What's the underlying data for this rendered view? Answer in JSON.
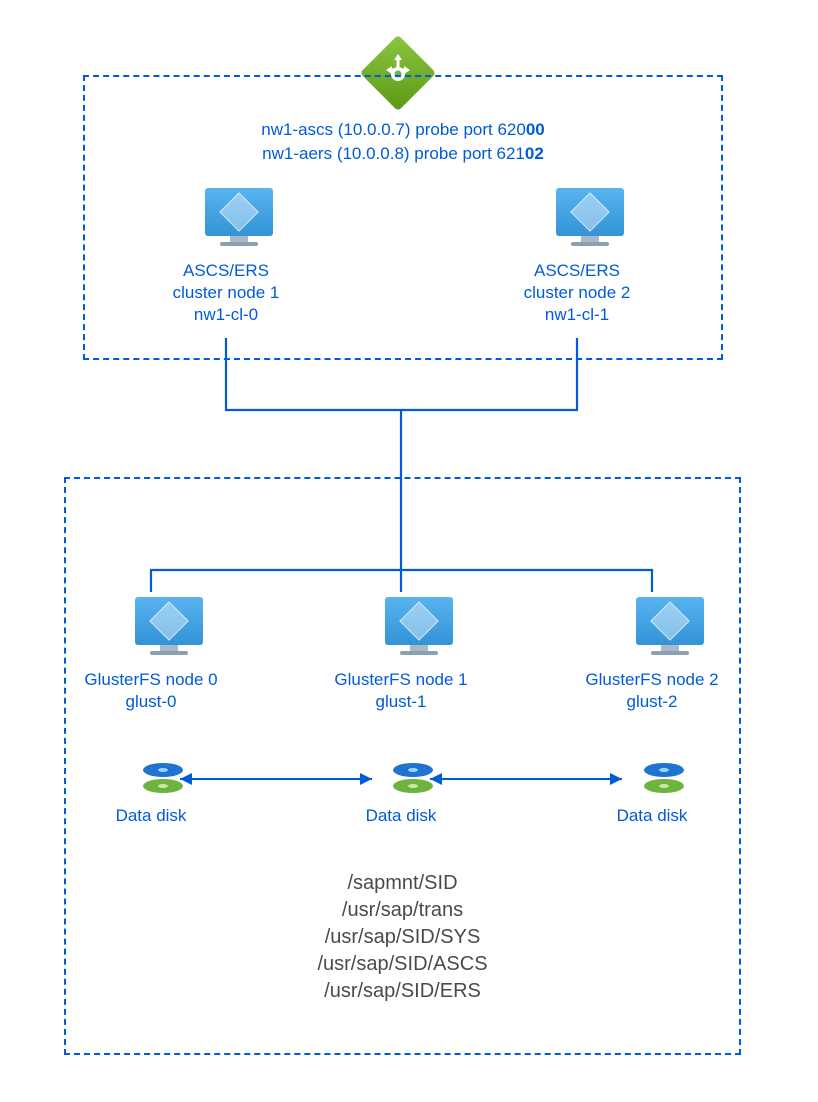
{
  "header": {
    "line1_prefix": "nw1-ascs (10.0.0.7) probe port 620",
    "line1_bold": "00",
    "line2_prefix": "nw1-aers (10.0.0.8) probe port 621",
    "line2_bold": "02"
  },
  "cluster_nodes": [
    {
      "title": "ASCS/ERS",
      "subtitle": "cluster node 1",
      "host": "nw1-cl-0"
    },
    {
      "title": "ASCS/ERS",
      "subtitle": "cluster node 2",
      "host": "nw1-cl-1"
    }
  ],
  "gluster_nodes": [
    {
      "title": "GlusterFS node 0",
      "host": "glust-0",
      "disk_label": "Data disk"
    },
    {
      "title": "GlusterFS node 1",
      "host": "glust-1",
      "disk_label": "Data disk"
    },
    {
      "title": "GlusterFS node 2",
      "host": "glust-2",
      "disk_label": "Data disk"
    }
  ],
  "paths": [
    "/sapmnt/SID",
    "/usr/sap/trans",
    "/usr/sap/SID/SYS",
    "/usr/sap/SID/ASCS",
    "/usr/sap/SID/ERS"
  ],
  "icons": {
    "load_balancer": "load-balancer-icon",
    "vm": "vm-icon",
    "disk": "disk-icon"
  }
}
